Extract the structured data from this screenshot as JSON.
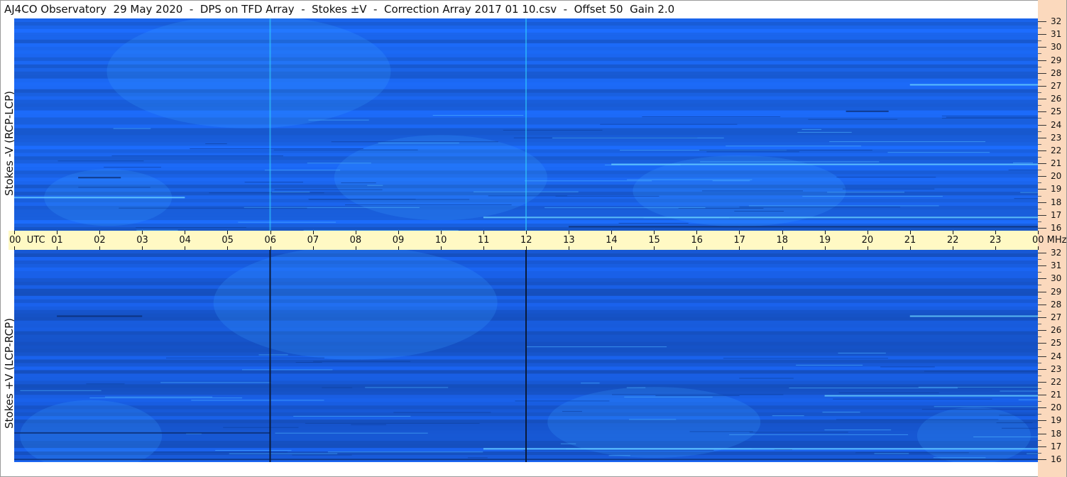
{
  "title": "AJ4CO Observatory  29 May 2020  -  DPS on TFD Array  -  Stokes ±V  -  Correction Array 2017 01 10.csv  -  Offset 50  Gain 2.0",
  "colors": {
    "spectrogram_base": "#1a63e8",
    "time_band": "#fff9c4",
    "freq_strip": "#fbd9bd",
    "bright_line": "#33d6ff",
    "dark_line": "#0a1a3a"
  },
  "chart_data": [
    {
      "type": "heatmap",
      "name": "top",
      "ylabel": "Stokes -V  (RCP-LCP)",
      "x_axis": {
        "unit": "UTC",
        "range": [
          0,
          24
        ]
      },
      "y_axis": {
        "unit": "MHz",
        "range": [
          16,
          32
        ],
        "ticks": [
          32,
          31,
          30,
          29,
          28,
          27,
          26,
          25,
          24,
          23,
          22,
          21,
          20,
          19,
          18,
          17,
          16
        ]
      },
      "vertical_markers": [
        {
          "utc": 6,
          "style": "bright"
        },
        {
          "utc": 12,
          "style": "bright"
        }
      ],
      "features": [
        {
          "type": "band",
          "mhz": 27.0,
          "start": 21.0,
          "end": 24.0
        },
        {
          "type": "band",
          "mhz": 25.0,
          "start": 19.5,
          "end": 20.5
        },
        {
          "type": "band",
          "mhz": 21.0,
          "start": 14.0,
          "end": 24.0
        },
        {
          "type": "band",
          "mhz": 20.0,
          "start": 1.5,
          "end": 2.5
        },
        {
          "type": "band",
          "mhz": 17.0,
          "start": 11.0,
          "end": 24.0
        },
        {
          "type": "band",
          "mhz": 16.3,
          "start": 13.0,
          "end": 24.0
        },
        {
          "type": "band",
          "mhz": 18.5,
          "start": 0.0,
          "end": 4.0
        }
      ]
    },
    {
      "type": "heatmap",
      "name": "bottom",
      "ylabel": "Stokes +V  (LCP-RCP)",
      "x_axis": {
        "unit": "UTC",
        "range": [
          0,
          24
        ]
      },
      "y_axis": {
        "unit": "MHz",
        "range": [
          16,
          32
        ],
        "ticks": [
          32,
          31,
          30,
          29,
          28,
          27,
          26,
          25,
          24,
          23,
          22,
          21,
          20,
          19,
          18,
          17,
          16
        ]
      },
      "vertical_markers": [
        {
          "utc": 6,
          "style": "dark"
        },
        {
          "utc": 12,
          "style": "dark"
        }
      ],
      "features": [
        {
          "type": "band",
          "mhz": 27.0,
          "start": 21.0,
          "end": 24.0
        },
        {
          "type": "band",
          "mhz": 27.0,
          "start": 1.0,
          "end": 3.0
        },
        {
          "type": "band",
          "mhz": 21.0,
          "start": 19.0,
          "end": 24.0
        },
        {
          "type": "band",
          "mhz": 18.2,
          "start": 0.0,
          "end": 6.0
        },
        {
          "type": "band",
          "mhz": 17.0,
          "start": 11.0,
          "end": 24.0
        },
        {
          "type": "band",
          "mhz": 16.2,
          "start": 0.0,
          "end": 24.0
        }
      ]
    }
  ],
  "time_axis": {
    "labels": [
      "00  UTC",
      "01",
      "02",
      "03",
      "04",
      "05",
      "06",
      "07",
      "08",
      "09",
      "10",
      "11",
      "12",
      "13",
      "14",
      "15",
      "16",
      "17",
      "18",
      "19",
      "20",
      "21",
      "22",
      "23",
      "00 MHz"
    ]
  },
  "freq_axis": {
    "labels": [
      "32",
      "31",
      "30",
      "29",
      "28",
      "27",
      "26",
      "25",
      "24",
      "23",
      "22",
      "21",
      "20",
      "19",
      "18",
      "17",
      "16"
    ]
  }
}
